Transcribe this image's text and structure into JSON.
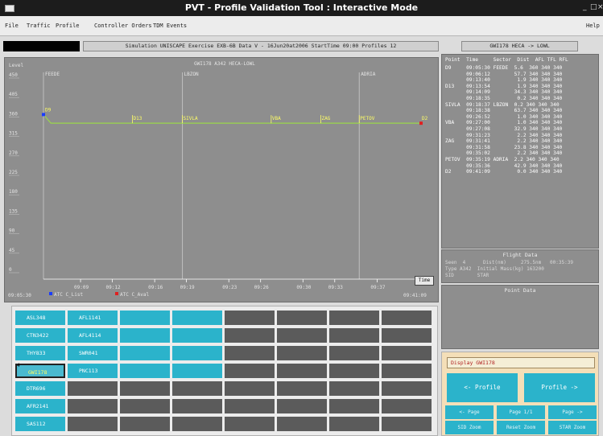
{
  "window": {
    "title": "PVT - Profile Validation Tool : Interactive Mode",
    "controls": [
      "_",
      "□",
      "×"
    ]
  },
  "menu": {
    "items": [
      "File",
      "Traffic",
      "Profile",
      "Controller Orders",
      "TDM Events"
    ],
    "help": "Help"
  },
  "info_bar": "Simulation UNISCAPE Exercise EXB-6B Data V - 16Jun20at2006 StartTime 09:00 Profiles 12",
  "flight_header": "GWI178  HECA -> LOWL",
  "chart": {
    "title": "GWI178  A342 HECA-LOWL",
    "ylabel": "Level",
    "time_button": "Time",
    "start_time": "09:05:30",
    "end_time": "09:41:09",
    "legend": [
      "ATC C_List",
      "ATC C_Aval"
    ]
  },
  "chart_data": {
    "type": "line",
    "ylabel": "Level",
    "ylim": [
      0,
      450
    ],
    "y_ticks": [
      0,
      45,
      90,
      135,
      180,
      225,
      270,
      315,
      360,
      405,
      450
    ],
    "x_ticks": [
      "09:09",
      "09:12",
      "09:16",
      "09:19",
      "09:23",
      "09:26",
      "09:30",
      "09:33",
      "09:37"
    ],
    "xlim": [
      "09:05:30",
      "09:41:09"
    ],
    "sectors": [
      "FEEDE",
      "LBZON",
      "ADRIA"
    ],
    "series": [
      {
        "name": "",
        "x": [
          "09:05:30",
          "09:06:12",
          "09:41:09"
        ],
        "y": [
          360,
          340,
          340
        ]
      }
    ],
    "waypoints": [
      {
        "name": "D9",
        "x": "09:05:30",
        "y": 360
      },
      {
        "name": "D13",
        "x": "09:13:54",
        "y": 340
      },
      {
        "name": "SIVLA",
        "x": "09:18:37",
        "y": 340
      },
      {
        "name": "VBA",
        "x": "09:27:00",
        "y": 340
      },
      {
        "name": "ZAG",
        "x": "09:31:41",
        "y": 340
      },
      {
        "name": "PETOV",
        "x": "09:35:19",
        "y": 340
      },
      {
        "name": "D2",
        "x": "09:41:09",
        "y": 340
      }
    ]
  },
  "table": {
    "headers": "Point  Time     Sector  Dist  AFL TFL RFL",
    "rows": [
      "D9     09:05:30 FEEDE  5.6  360 340 340",
      "       09:06:12        57.7 340 340 340",
      "       09:13:40         1.9 340 340 340",
      "D13    09:13:54         1.9 340 340 340",
      "       09:14:09        34.3 340 340 340",
      "       09:18:35         0.2 340 340 340",
      "SIVLA  09:18:37 LBZON  0.2 340 340 340",
      "       09:18:38        63.7 340 340 340",
      "       09:26:52         1.0 340 340 340",
      "VBA    09:27:00         1.0 340 340 340",
      "       09:27:08        32.9 340 340 340",
      "       09:31:23         2.2 340 340 340",
      "ZAG    09:31:41         2.2 340 340 340",
      "       09:31:58        23.8 340 340 340",
      "       09:35:02         2.2 340 340 340",
      "PETOV  09:35:19 ADRIA  2.2 340 340 340",
      "       09:35:36        42.9 340 340 340",
      "D2     09:41:09         0.0 340 340 340"
    ]
  },
  "flight_data": {
    "title": "Flight Data",
    "line1": "Seen  4      Dist(nm)     275.5nm   00:35:39",
    "line2": "Type A342  Initial Mass(kg) 163200",
    "line3": "SID        STAR"
  },
  "point_data": {
    "title": "Point Data"
  },
  "callsigns": {
    "rows": [
      [
        "ASL348",
        "AFL1141",
        "",
        "",
        "",
        "",
        "",
        ""
      ],
      [
        "CTN3422",
        "AFL4114",
        "",
        "",
        "",
        "",
        "",
        ""
      ],
      [
        "THY833",
        "SWR041",
        "",
        "",
        "",
        "",
        "",
        ""
      ],
      [
        "GWI178",
        "PNC113",
        "",
        "",
        "",
        "",
        "",
        ""
      ],
      [
        "DTR696",
        "",
        "",
        "",
        "",
        "",
        "",
        ""
      ],
      [
        "AFR2141",
        "",
        "",
        "",
        "",
        "",
        "",
        ""
      ],
      [
        "SAS112",
        "",
        "",
        "",
        "",
        "",
        "",
        ""
      ]
    ],
    "selected_marker": "4"
  },
  "controls": {
    "display_label": "Display GWI178",
    "prev_profile": "<- Profile",
    "next_profile": "Profile ->",
    "prev_page": "<- Page",
    "page_info": "Page 1/1",
    "next_page": "Page ->",
    "sid_zoom": "SID Zoom",
    "reset_zoom": "Reset Zoom",
    "star_zoom": "STAR Zoom"
  },
  "colors": {
    "cyan": "#2bb3cb",
    "dark_cell": "#5b5b5b",
    "profile_line": "#9ad64a",
    "waypoint": "#ffff66",
    "start_marker": "#1a3cff",
    "end_marker": "#e02020"
  }
}
